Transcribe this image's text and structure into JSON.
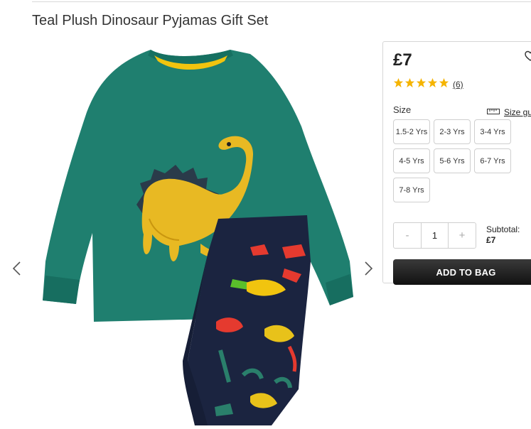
{
  "product": {
    "title": "Teal Plush Dinosaur Pyjamas Gift Set"
  },
  "purchase": {
    "price": "£7",
    "rating": {
      "stars": 5,
      "max": 5,
      "review_count": "(6)"
    },
    "size_label": "Size",
    "size_guide_label": "Size gu",
    "sizes": [
      "1.5-2 Yrs",
      "2-3 Yrs",
      "3-4 Yrs",
      "4-5 Yrs",
      "5-6 Yrs",
      "6-7 Yrs",
      "7-8 Yrs"
    ],
    "quantity": {
      "minus": "-",
      "value": "1",
      "plus": "+"
    },
    "subtotal_label": "Subtotal:",
    "subtotal_value": "£7",
    "add_to_bag": "ADD TO BAG"
  },
  "colors": {
    "accent_star": "#f5b400",
    "button_dark": "#1a1a1a",
    "teal": "#1f7f6f",
    "navy": "#1b2440",
    "mustard": "#f1c40f"
  },
  "icons": {
    "prev": "chevron-left-icon",
    "next": "chevron-right-icon",
    "wishlist": "heart-icon",
    "size_guide": "ruler-icon"
  }
}
